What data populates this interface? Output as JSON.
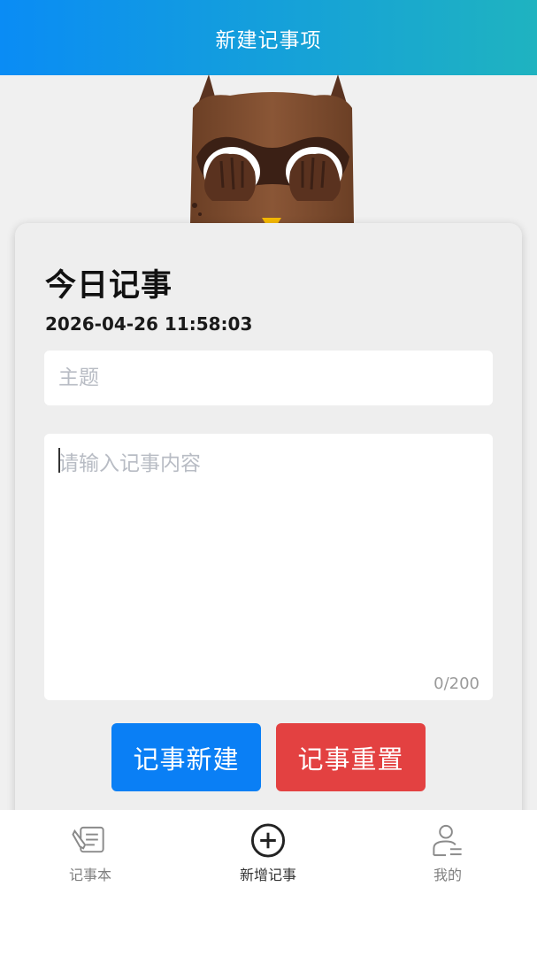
{
  "header": {
    "title": "新建记事项"
  },
  "card": {
    "title": "今日记事",
    "datetime": "2026-04-26 11:58:03",
    "subject_placeholder": "主题",
    "subject_value": "",
    "content_placeholder": "请输入记事内容",
    "content_value": "",
    "word_count": "0/200"
  },
  "buttons": {
    "create_label": "记事新建",
    "reset_label": "记事重置"
  },
  "tabbar": {
    "items": [
      {
        "label": "记事本",
        "icon": "notebook-icon",
        "active": false
      },
      {
        "label": "新增记事",
        "icon": "add-circle-icon",
        "active": true
      },
      {
        "label": "我的",
        "icon": "user-icon",
        "active": false
      }
    ]
  },
  "colors": {
    "header_gradient_start": "#0a8cf5",
    "header_gradient_end": "#1fb3c0",
    "primary_button": "#0a7ff5",
    "danger_button": "#e34141"
  }
}
